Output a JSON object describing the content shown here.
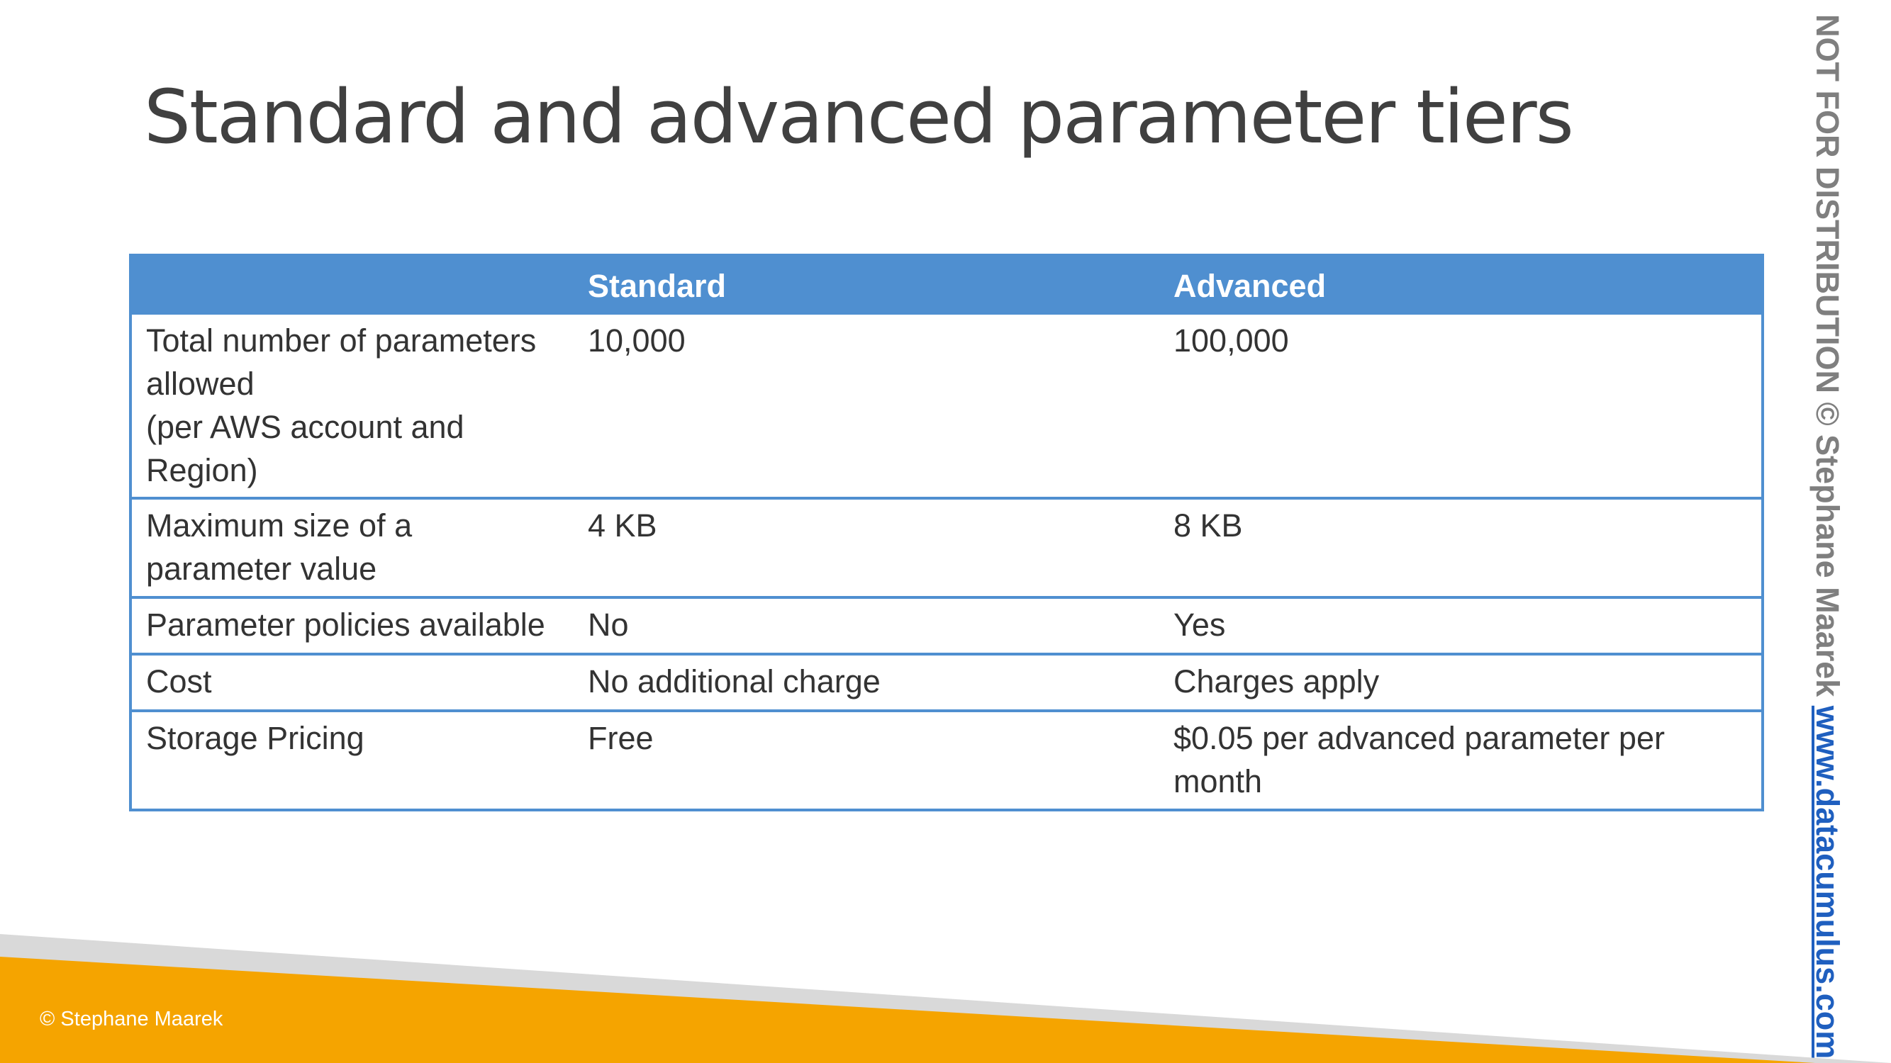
{
  "slide": {
    "title": "Standard and advanced parameter tiers"
  },
  "table": {
    "headers": [
      "",
      "Standard",
      "Advanced"
    ],
    "rows": [
      {
        "feature_lines": [
          "Total number of parameters",
          "allowed",
          "(per AWS account and",
          "Region)"
        ],
        "standard": "10,000",
        "advanced": "100,000"
      },
      {
        "feature_lines": [
          "Maximum size of a",
          "parameter value"
        ],
        "standard": "4 KB",
        "advanced": "8 KB"
      },
      {
        "feature_lines": [
          "Parameter policies available"
        ],
        "standard": "No",
        "advanced": "Yes"
      },
      {
        "feature_lines": [
          "Cost"
        ],
        "standard": "No additional charge",
        "advanced": "Charges apply"
      },
      {
        "feature_lines": [
          "Storage Pricing"
        ],
        "standard": "Free",
        "advanced_lines": [
          "$0.05 per advanced parameter per",
          "month"
        ]
      }
    ]
  },
  "watermark": {
    "text": "NOT FOR DISTRIBUTION © Stephane Maarek ",
    "link": "www.datacumulus.com"
  },
  "footer": {
    "copyright": "© Stephane Maarek"
  },
  "colors": {
    "header_blue": "#4f8fd0",
    "footer_orange": "#f5a400",
    "footer_gray": "#d9d9d9",
    "title_text": "#404040",
    "link_blue": "#1f5fbf"
  }
}
